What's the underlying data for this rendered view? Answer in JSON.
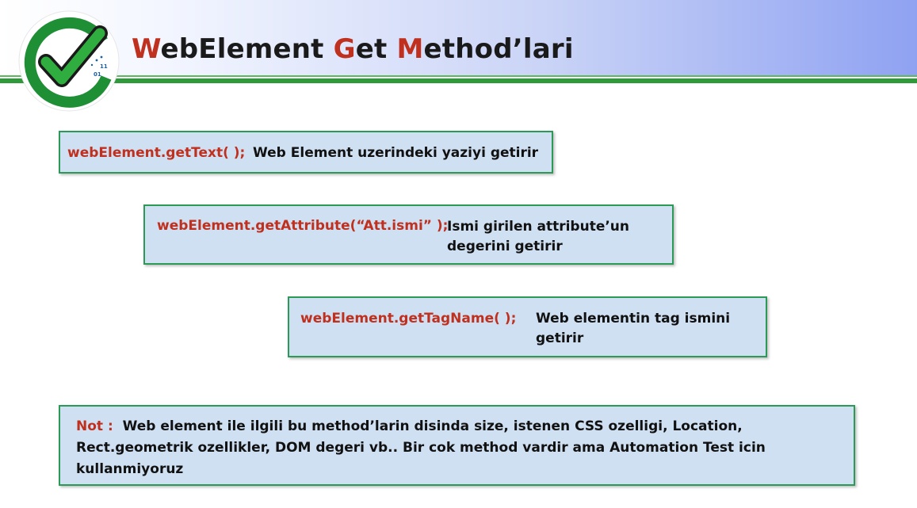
{
  "slide": {
    "title_parts": [
      {
        "text": "W",
        "accent": true
      },
      {
        "text": "ebElement ",
        "accent": false
      },
      {
        "text": "G",
        "accent": true
      },
      {
        "text": "et ",
        "accent": false
      },
      {
        "text": "M",
        "accent": true
      },
      {
        "text": "ethod’lari",
        "accent": false
      }
    ],
    "logo_digits": [
      "01",
      "11"
    ],
    "colors": {
      "accent_red": "#c0301e",
      "box_fill": "#cfe0f3",
      "box_border": "#2c9a57",
      "header_line": "#2f9a3a"
    }
  },
  "items": [
    {
      "code": "webElement.getText( );",
      "desc": "Web Element uzerindeki yaziyi getirir"
    },
    {
      "code": "webElement.getAttribute(“Att.ismi” );",
      "desc": "Ismi girilen attribute’un degerini getirir"
    },
    {
      "code": "webElement.getTagName( );",
      "desc": "Web elementin tag ismini getirir"
    }
  ],
  "note": {
    "label": "Not :",
    "text": "Web element ile ilgili bu method’larin disinda size, istenen CSS ozelligi, Location, Rect.geometrik ozellikler, DOM degeri vb.. Bir cok method vardir ama Automation Test icin kullanmiyoruz"
  }
}
